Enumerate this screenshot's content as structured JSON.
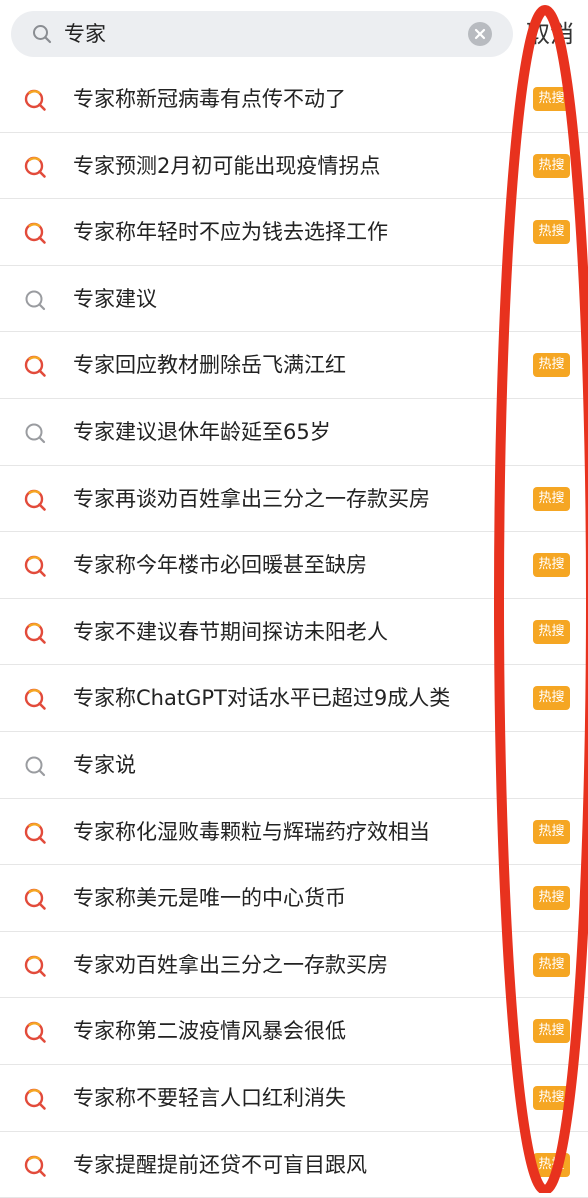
{
  "search": {
    "query": "专家",
    "cancel_label": "取消"
  },
  "colors": {
    "hot_badge": "#f5a623",
    "annotation": "#e8321e"
  },
  "suggestions": [
    {
      "text": "专家称新冠病毒有点传不动了",
      "icon": "hot-search-icon",
      "badge": "热搜"
    },
    {
      "text": "专家预测2月初可能出现疫情拐点",
      "icon": "hot-search-icon",
      "badge": "热搜"
    },
    {
      "text": "专家称年轻时不应为钱去选择工作",
      "icon": "hot-search-icon",
      "badge": "热搜"
    },
    {
      "text": "专家建议",
      "icon": "search-icon",
      "badge": null
    },
    {
      "text": "专家回应教材删除岳飞满江红",
      "icon": "hot-search-icon",
      "badge": "热搜"
    },
    {
      "text": "专家建议退休年龄延至65岁",
      "icon": "search-icon",
      "badge": null
    },
    {
      "text": "专家再谈劝百姓拿出三分之一存款买房",
      "icon": "hot-search-icon",
      "badge": "热搜"
    },
    {
      "text": "专家称今年楼市必回暖甚至缺房",
      "icon": "hot-search-icon",
      "badge": "热搜"
    },
    {
      "text": "专家不建议春节期间探访未阳老人",
      "icon": "hot-search-icon",
      "badge": "热搜"
    },
    {
      "text": "专家称ChatGPT对话水平已超过9成人类",
      "icon": "hot-search-icon",
      "badge": "热搜"
    },
    {
      "text": "专家说",
      "icon": "search-icon",
      "badge": null
    },
    {
      "text": "专家称化湿败毒颗粒与辉瑞药疗效相当",
      "icon": "hot-search-icon",
      "badge": "热搜"
    },
    {
      "text": "专家称美元是唯一的中心货币",
      "icon": "hot-search-icon",
      "badge": "热搜"
    },
    {
      "text": "专家劝百姓拿出三分之一存款买房",
      "icon": "hot-search-icon",
      "badge": "热搜"
    },
    {
      "text": "专家称第二波疫情风暴会很低",
      "icon": "hot-search-icon",
      "badge": "热搜"
    },
    {
      "text": "专家称不要轻言人口红利消失",
      "icon": "hot-search-icon",
      "badge": "热搜"
    },
    {
      "text": "专家提醒提前还贷不可盲目跟风",
      "icon": "hot-search-icon",
      "badge": "热搜"
    }
  ]
}
